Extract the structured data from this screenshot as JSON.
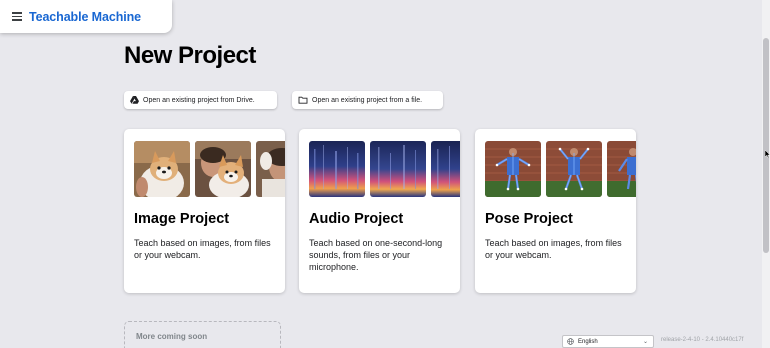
{
  "app": {
    "title": "Teachable Machine",
    "menu_icon": "hamburger-menu-icon"
  },
  "page": {
    "title": "New Project"
  },
  "actions": {
    "open_drive": {
      "label": "Open an existing project from Drive.",
      "icon": "google-drive-icon"
    },
    "open_file": {
      "label": "Open an existing project from a file.",
      "icon": "folder-icon"
    }
  },
  "projects": [
    {
      "title": "Image Project",
      "description": "Teach based on images, from files or your webcam."
    },
    {
      "title": "Audio Project",
      "description": "Teach based on one-second-long sounds, from files or your microphone."
    },
    {
      "title": "Pose Project",
      "description": "Teach based on images, from files or your webcam."
    }
  ],
  "more": {
    "label": "More coming soon"
  },
  "footer": {
    "language": "English",
    "version": "release-2-4-10 - 2.4.10440c17f"
  },
  "colors": {
    "accent": "#1967d2",
    "background": "#e8e8ed",
    "card": "#ffffff"
  }
}
